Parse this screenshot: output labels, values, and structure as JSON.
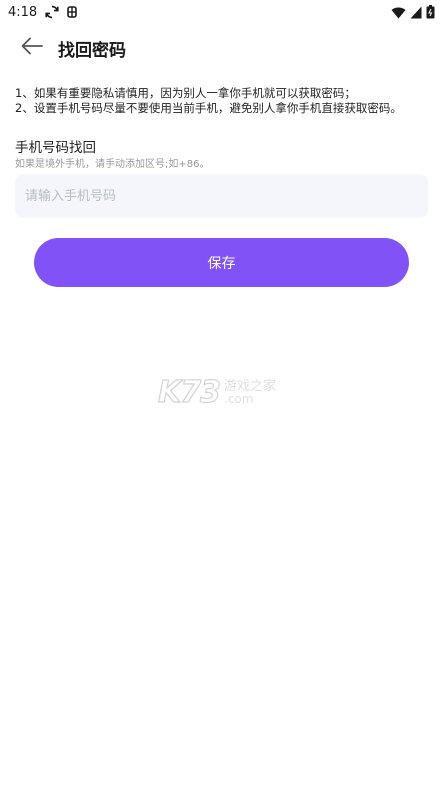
{
  "status_bar": {
    "time": "4:18",
    "left_icons": [
      "sync-icon",
      "bug-icon"
    ],
    "right_icons": [
      "wifi-icon",
      "signal-icon",
      "battery-icon"
    ]
  },
  "header": {
    "back_icon": "arrow-left-icon",
    "title": "找回密码"
  },
  "tips": {
    "line1": "1、如果有重要隐私请慎用，因为别人一拿你手机就可以获取密码；",
    "line2": "2、设置手机号码尽量不要使用当前手机，避免别人拿你手机直接获取密码。"
  },
  "phone_section": {
    "title": "手机号码找回",
    "hint": "如果是境外手机，请手动添加区号;如+86。",
    "input_value": "",
    "input_placeholder": "请输入手机号码"
  },
  "actions": {
    "save_label": "保存"
  },
  "watermark": {
    "logo": "K73",
    "cn": "游戏之家",
    "com": ".com"
  },
  "colors": {
    "accent": "#8152f5",
    "input_bg": "#f4f6fb",
    "hint": "#999999"
  }
}
